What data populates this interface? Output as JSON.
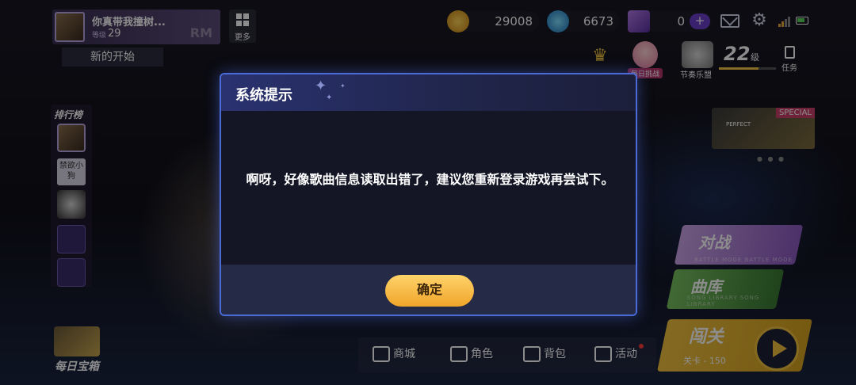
{
  "profile": {
    "name": "你真带我撞树...",
    "level_label": "等级",
    "level": "29",
    "watermark": "RM"
  },
  "more": {
    "label": "更多"
  },
  "subtitle": "新的开始",
  "currencies": [
    {
      "icon": "music-coin-icon",
      "value": "29008",
      "color": "#e6a21d"
    },
    {
      "icon": "blue-gem-icon",
      "value": "6673",
      "color": "#2aa3d8"
    },
    {
      "icon": "ticket-card-icon",
      "value": "0",
      "color": "#7b4fd0"
    }
  ],
  "top_icons": {
    "daily_challenge_label": "每日挑战",
    "rhythm_label": "节奏乐盟",
    "level_value": "22",
    "level_unit": "级",
    "level_progress": 0.7,
    "task_label": "任务"
  },
  "leaderboard": {
    "title": "排行榜",
    "tag": "禁欲小狗"
  },
  "special_banner": {
    "tag": "SPECIAL",
    "perfect": "PERFECT"
  },
  "modes": [
    {
      "label": "对战",
      "sub": "BATTLE MODE BATTLE MODE",
      "color": "#b58ad8"
    },
    {
      "label": "曲库",
      "sub": "SONG LIBRARY SONG LIBRARY",
      "color": "#5aa84a"
    }
  ],
  "stage": {
    "label": "闯关",
    "sub": "关卡 - 150"
  },
  "bottom_nav": [
    {
      "label": "商城",
      "icon": "shop-icon"
    },
    {
      "label": "角色",
      "icon": "character-card-icon"
    },
    {
      "label": "背包",
      "icon": "backpack-icon"
    },
    {
      "label": "活动",
      "icon": "gift-icon"
    }
  ],
  "chest": {
    "label": "每日宝箱"
  },
  "dialog": {
    "title": "系统提示",
    "message": "啊呀，好像歌曲信息读取出错了，建议您重新登录游戏再尝试下。",
    "confirm_label": "确定"
  }
}
